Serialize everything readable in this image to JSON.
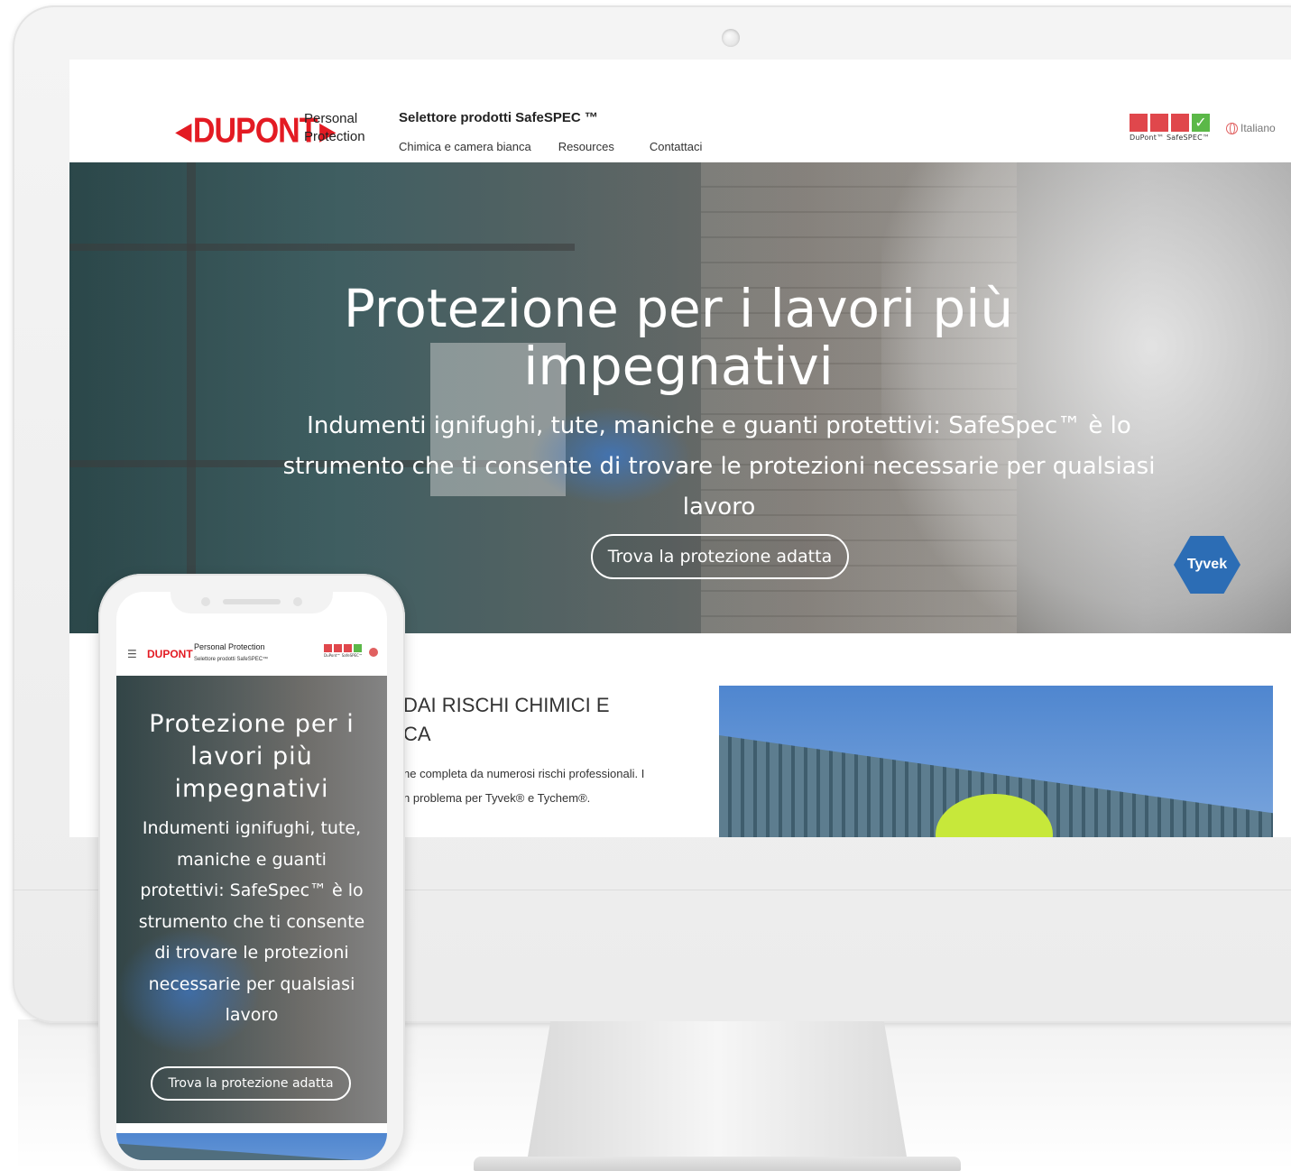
{
  "desktop": {
    "brand": {
      "logo_text": "DUPONT",
      "sub_line1": "Personal",
      "sub_line2": "Protection"
    },
    "site_title": "Selettore prodotti SafeSPEC ™",
    "nav": [
      {
        "label": "Chimica e camera bianca"
      },
      {
        "label": "Resources"
      },
      {
        "label": "Contattaci"
      }
    ],
    "safespec_logo": {
      "check": "✓",
      "tag": "DuPont™ SafeSPEC™"
    },
    "language": "Italiano",
    "hero": {
      "title": "Protezione per i lavori più impegnativi",
      "subtitle": "Indumenti ignifughi, tute, maniche e guanti protettivi: SafeSpec™ è lo strumento che ti consente di trovare le protezioni necessarie per qualsiasi lavoro",
      "cta": "Trova la protezione adatta",
      "badge": "Tyvek"
    },
    "section": {
      "heading_line1": "DAI RISCHI CHIMICI E",
      "heading_line2": "CA",
      "text_line1": "ne completa da numerosi rischi professionali. I",
      "text_line2": "n problema per Tyvek® e Tychem®."
    }
  },
  "mobile": {
    "menu_icon": "☰",
    "logo_text": "DUPONT",
    "brand": "Personal Protection",
    "site_title": "Selettore prodotti SafeSPEC™",
    "safespec_tag": "DuPont™ SafeSPEC™",
    "hero": {
      "title": "Protezione per i lavori più impegnativi",
      "subtitle": "Indumenti ignifughi, tute, maniche e guanti protettivi: SafeSpec™ è lo strumento che ti consente di trovare le protezioni necessarie per qualsiasi lavoro",
      "cta": "Trova la protezione adatta"
    }
  },
  "colors": {
    "brand_red": "#e31b23",
    "safespec_red": "#e0474c",
    "safespec_green": "#5bb848",
    "tyvek_blue": "#2c6db5"
  }
}
